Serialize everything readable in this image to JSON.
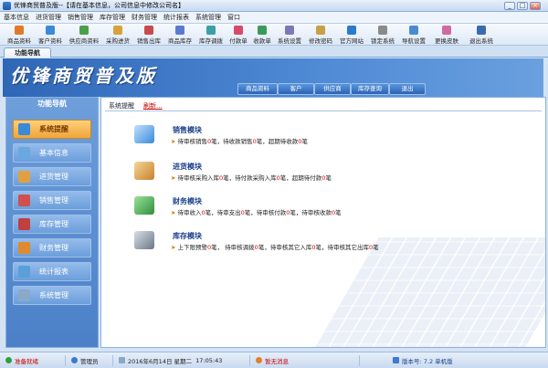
{
  "window": {
    "title": "优锋商贸普及版--【请在基本信息，公司信息中修改公司名】",
    "btn_min": "_",
    "btn_max": "□",
    "btn_close": "×"
  },
  "menu": [
    "基本信息",
    "进货管理",
    "销售管理",
    "库存管理",
    "财务管理",
    "统计报表",
    "系统管理",
    "窗口"
  ],
  "toolbar": [
    {
      "label": "商品资料",
      "color": "#e07a2a"
    },
    {
      "label": "客户资料",
      "color": "#3a8ad8"
    },
    {
      "label": "供应商资料",
      "color": "#4aa04a"
    },
    {
      "label": "采购进货",
      "color": "#d8a23a"
    },
    {
      "label": "销售出库",
      "color": "#c84a4a"
    },
    {
      "label": "商品库存",
      "color": "#5a7ad0"
    },
    {
      "label": "库存调拨",
      "color": "#3aa0a8"
    },
    {
      "label": "付款单",
      "color": "#d84a6a"
    },
    {
      "label": "收款单",
      "color": "#3a9a5a"
    },
    {
      "label": "系统设置",
      "color": "#7a7ab8"
    },
    {
      "label": "修改密码",
      "color": "#c8a048"
    },
    {
      "label": "官方网站",
      "color": "#2a7ad0"
    },
    {
      "label": "锁定系统",
      "color": "#8a8a8a"
    },
    {
      "label": "导航设置",
      "color": "#4a8ad0"
    },
    {
      "label": "更换皮肤",
      "color": "#d06aa0"
    },
    {
      "label": "退出系统",
      "color": "#3a6ab0"
    }
  ],
  "tab": {
    "label": "功能导航"
  },
  "banner": {
    "title": "优锋商贸普及版",
    "nav": [
      "商品资料",
      "客户",
      "供应商",
      "库存查询",
      "退出"
    ]
  },
  "sidebar": {
    "title": "功能导航",
    "items": [
      {
        "label": "系统提醒",
        "color": "#3a8ad8",
        "active": true
      },
      {
        "label": "基本信息",
        "color": "#6aa8e0",
        "active": false
      },
      {
        "label": "进货管理",
        "color": "#e0a040",
        "active": false
      },
      {
        "label": "销售管理",
        "color": "#d05050",
        "active": false
      },
      {
        "label": "库存管理",
        "color": "#c04040",
        "active": false
      },
      {
        "label": "财务管理",
        "color": "#e08a30",
        "active": false
      },
      {
        "label": "统计报表",
        "color": "#5aa0d8",
        "active": false
      },
      {
        "label": "系统管理",
        "color": "#8aa8c8",
        "active": false
      }
    ]
  },
  "content": {
    "tab": "系统提醒",
    "refresh": "刷新...",
    "modules": [
      {
        "title": "销售模块",
        "color": "#5aa0e0",
        "parts": [
          "待审核销售",
          "0",
          "笔，待收款销售",
          "0",
          "笔，超期待收款",
          "0",
          "笔"
        ]
      },
      {
        "title": "进货模块",
        "color": "#d8a050",
        "parts": [
          "待审核采购入库",
          "0",
          "笔，待付款采购入库",
          "0",
          "笔，超期待付款",
          "0",
          "笔"
        ]
      },
      {
        "title": "财务模块",
        "color": "#3aa040",
        "parts": [
          "待审收入",
          "0",
          "笔，待审支出",
          "0",
          "笔，待审核付款",
          "0",
          "笔，待审核收款",
          "0",
          "笔"
        ]
      },
      {
        "title": "库存模块",
        "color": "#7a8a98",
        "parts": [
          "上下限预警",
          "0",
          "笔， 待审核调拨",
          "0",
          "笔，待审核其它入库",
          "0",
          "笔，待审核其它出库",
          "0",
          "笔"
        ]
      }
    ]
  },
  "status": {
    "online": "准备就绪",
    "user": "管理员",
    "date": "2016年6月14日",
    "weekday": "星期二",
    "time": "17:05:43",
    "msg": "暂无消息",
    "version": "版本号: 7.2 单机版"
  }
}
